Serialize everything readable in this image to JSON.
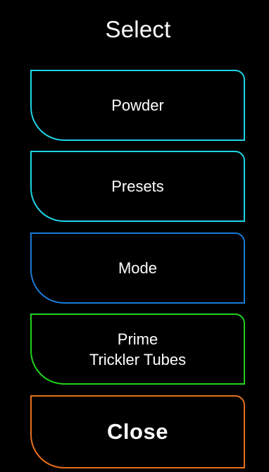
{
  "header": {
    "title": "Select"
  },
  "menu": {
    "powder": {
      "label": "Powder",
      "color": "#1ed4e6"
    },
    "presets": {
      "label": "Presets",
      "color": "#1ed4e6"
    },
    "mode": {
      "label": "Mode",
      "color": "#1a7ad4"
    },
    "prime_trickler_tubes": {
      "label": "Prime\nTrickler Tubes",
      "color": "#22d11e"
    },
    "close": {
      "label": "Close",
      "color": "#e8701c"
    }
  },
  "theme": {
    "background": "#000000",
    "text": "#ffffff"
  }
}
